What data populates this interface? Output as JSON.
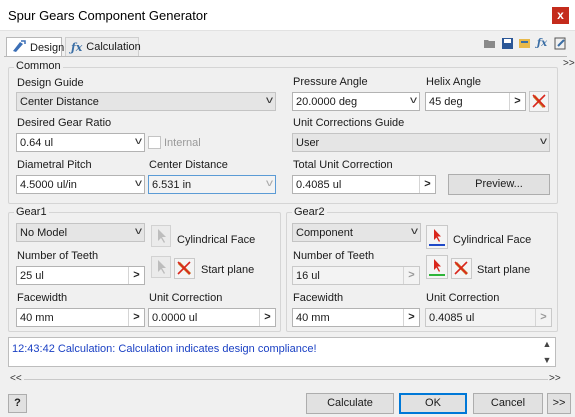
{
  "window": {
    "title": "Spur Gears Component Generator",
    "close_glyph": "x"
  },
  "tabs": [
    {
      "label": "Design",
      "icon": "gear-design-icon"
    },
    {
      "label": "Calculation",
      "icon": "fx-calculation-icon"
    }
  ],
  "common": {
    "title": "Common",
    "design_guide": {
      "label": "Design Guide",
      "value": "Center Distance"
    },
    "desired_gear_ratio": {
      "label": "Desired Gear Ratio",
      "value": "0.64 ul"
    },
    "internal": {
      "label": "Internal",
      "checked": false
    },
    "diametral_pitch": {
      "label": "Diametral Pitch",
      "value": "4.5000 ul/in"
    },
    "center_distance": {
      "label": "Center Distance",
      "value": "6.531 in"
    },
    "pressure_angle": {
      "label": "Pressure Angle",
      "value": "20.0000 deg"
    },
    "helix_angle": {
      "label": "Helix Angle",
      "value": "45 deg"
    },
    "unit_corrections_guide": {
      "label": "Unit Corrections Guide",
      "value": "User"
    },
    "total_unit_correction": {
      "label": "Total Unit Correction",
      "value": "0.4085 ul"
    },
    "preview_label": "Preview..."
  },
  "gear1": {
    "title": "Gear1",
    "model": "No Model",
    "cylindrical_face_label": "Cylindrical Face",
    "number_of_teeth": {
      "label": "Number of Teeth",
      "value": "25 ul"
    },
    "start_plane_label": "Start plane",
    "facewidth": {
      "label": "Facewidth",
      "value": "40 mm"
    },
    "unit_correction": {
      "label": "Unit Correction",
      "value": "0.0000 ul"
    }
  },
  "gear2": {
    "title": "Gear2",
    "model": "Component",
    "cylindrical_face_label": "Cylindrical Face",
    "number_of_teeth": {
      "label": "Number of Teeth",
      "value": "16 ul"
    },
    "start_plane_label": "Start plane",
    "facewidth": {
      "label": "Facewidth",
      "value": "40 mm"
    },
    "unit_correction": {
      "label": "Unit Correction",
      "value": "0.4085 ul"
    }
  },
  "status_message": "12:43:42 Calculation: Calculation indicates design compliance!",
  "footer": {
    "help_glyph": "?",
    "calculate_label": "Calculate",
    "ok_label": "OK",
    "cancel_label": "Cancel",
    "more_label": ">>"
  },
  "glyphs": {
    "arrow": ">",
    "chevron": "v",
    "expand": ">>",
    "collapse": "<<"
  },
  "colors": {
    "close_red": "#c42b1c",
    "status_text": "#1b41c4",
    "ok_border": "#0078d7",
    "selection_red": "#d9261c"
  }
}
